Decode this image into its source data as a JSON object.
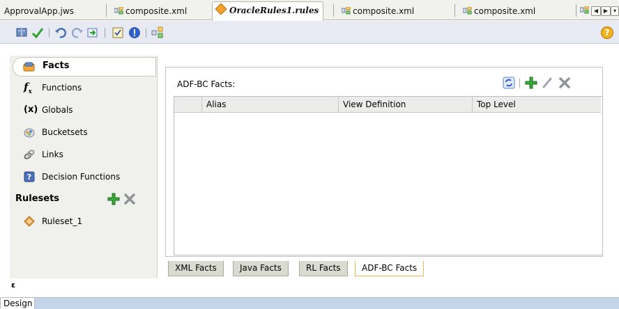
{
  "editor_tabs": [
    {
      "label": "ApprovalApp.jws"
    },
    {
      "label": "composite.xml"
    },
    {
      "label": "OracleRules1.rules"
    },
    {
      "label": "composite.xml"
    },
    {
      "label": "composite.xml"
    }
  ],
  "toolbar": {
    "help_glyph": "?"
  },
  "nav": {
    "facts": "Facts",
    "functions": "Functions",
    "globals_prefix": "(x)",
    "globals": "Globals",
    "bucketsets": "Bucketsets",
    "links": "Links",
    "decision_functions": "Decision Functions",
    "rulesets_header": "Rulesets",
    "ruleset_item": "Ruleset_1",
    "collapse_glyph": "ε"
  },
  "main": {
    "title": "ADF-BC Facts:",
    "columns": [
      "Alias",
      "View Definition",
      "Top Level"
    ],
    "rows": []
  },
  "fact_tabs": [
    "XML Facts",
    "Java Facts",
    "RL Facts",
    "ADF-BC Facts"
  ],
  "bottom": {
    "design_tab": "Design"
  },
  "colors": {
    "accent_orange": "#f7a12a",
    "add_green": "#2fa82c",
    "bottom_bar": "#c4d5ea"
  }
}
